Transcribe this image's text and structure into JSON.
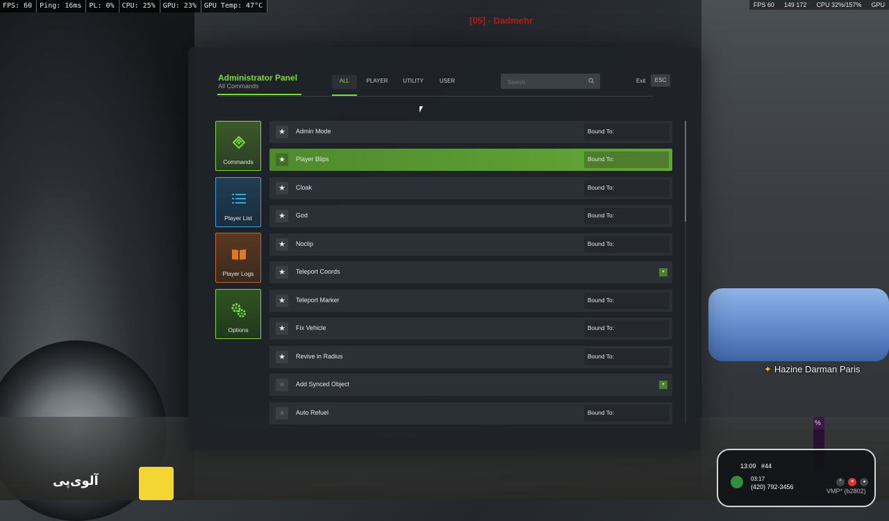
{
  "perf": {
    "fps": "FPS: 60",
    "ping": "Ping: 16ms",
    "pl": "PL: 0%",
    "cpu": "CPU: 25%",
    "gpu": "GPU: 23%",
    "gpu_temp": "GPU Temp: 47°C"
  },
  "perf_right": {
    "fps": "FPS 60",
    "ms": "149 172",
    "cpu": "CPU 32%/157%",
    "gpu": "GPU"
  },
  "server_title": "[05] - Dadmehr",
  "panel": {
    "title": "Administrator Panel",
    "subtitle": "All Commands",
    "tabs": [
      {
        "label": "ALL",
        "active": true
      },
      {
        "label": "PLAYER",
        "active": false
      },
      {
        "label": "UTILITY",
        "active": false
      },
      {
        "label": "USER",
        "active": false
      }
    ],
    "search_placeholder": "Search",
    "exit_label": "Exit",
    "esc_label": "ESC"
  },
  "sidebar": {
    "items": [
      {
        "label": "Commands",
        "icon": "commands-icon",
        "color": "#7ddc3a"
      },
      {
        "label": "Player List",
        "icon": "list-icon",
        "color": "#3aa6e0"
      },
      {
        "label": "Player Logs",
        "icon": "book-icon",
        "color": "#e07a22"
      },
      {
        "label": "Options",
        "icon": "gears-icon",
        "color": "#7ddc3a"
      }
    ]
  },
  "commands": [
    {
      "name": "Admin Mode",
      "bound_label": "Bound To:",
      "type": "bind",
      "favorite": true
    },
    {
      "name": "Player Blips",
      "bound_label": "Bound To:",
      "type": "bind",
      "favorite": true,
      "active": true
    },
    {
      "name": "Cloak",
      "bound_label": "Bound To:",
      "type": "bind",
      "favorite": true
    },
    {
      "name": "God",
      "bound_label": "Bound To:",
      "type": "bind",
      "favorite": true
    },
    {
      "name": "Noclip",
      "bound_label": "Bound To:",
      "type": "bind",
      "favorite": true
    },
    {
      "name": "Teleport Coords",
      "bound_label": "",
      "type": "expand",
      "favorite": true
    },
    {
      "name": "Teleport Marker",
      "bound_label": "Bound To:",
      "type": "bind",
      "favorite": true
    },
    {
      "name": "Fix Vehicle",
      "bound_label": "Bound To:",
      "type": "bind",
      "favorite": true
    },
    {
      "name": "Revive in Radius",
      "bound_label": "Bound To:",
      "type": "bind",
      "favorite": true
    },
    {
      "name": "Add Synced Object",
      "bound_label": "",
      "type": "expand",
      "favorite": false
    },
    {
      "name": "Auto Refuel",
      "bound_label": "Bound To:",
      "type": "bind",
      "favorite": false
    }
  ],
  "hud": {
    "player_tag": "Hazine Darman Paris",
    "phone_time": "13:09",
    "phone_id": "#44",
    "call_duration": "03:17",
    "call_number": "(420) 792-3456",
    "logo_text": "آلوی‌پی",
    "footer": "VMP* (b2802)"
  },
  "colors": {
    "accent": "#7ddc3a",
    "panel_bg": "#1e2228",
    "row_bg": "#2b3037",
    "active_row": "#5a9a32"
  }
}
